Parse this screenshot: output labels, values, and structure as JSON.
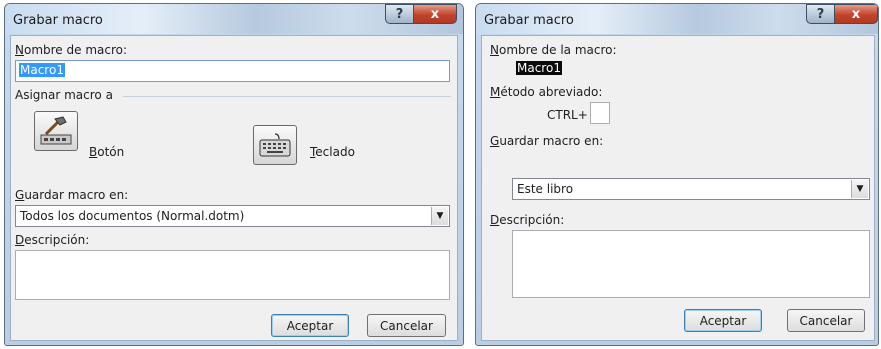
{
  "left_dialog": {
    "title": "Grabar macro",
    "help_glyph": "?",
    "close_glyph": "x",
    "name_label_mnemonic": "N",
    "name_label_rest": "ombre de macro:",
    "name_value": "Macro1",
    "assign_label": "Asignar macro a",
    "button_label_mnemonic": "B",
    "button_label_rest": "otón",
    "keyboard_label_mnemonic": "T",
    "keyboard_label_rest": "eclado",
    "store_label_mnemonic": "G",
    "store_label_rest": "uardar macro en:",
    "store_value": "Todos los documentos (Normal.dotm)",
    "desc_label_mnemonic": "D",
    "desc_label_rest": "escripción:",
    "ok_label": "Aceptar",
    "cancel_label": "Cancelar"
  },
  "right_dialog": {
    "title": "Grabar macro",
    "help_glyph": "?",
    "close_glyph": "x",
    "name_label_mnemonic": "N",
    "name_label_rest": "ombre de la macro:",
    "name_value": "Macro1",
    "shortcut_label_mnemonic": "M",
    "shortcut_label_rest": "étodo abreviado:",
    "ctrl_label": "CTRL+",
    "store_label_mnemonic": "G",
    "store_label_rest": "uardar macro en:",
    "store_value": "Este libro",
    "desc_label_mnemonic": "D",
    "desc_label_rest": "escripción:",
    "ok_label": "Aceptar",
    "cancel_label": "Cancelar"
  },
  "icons": {
    "dropdown_arrow": "▼"
  }
}
